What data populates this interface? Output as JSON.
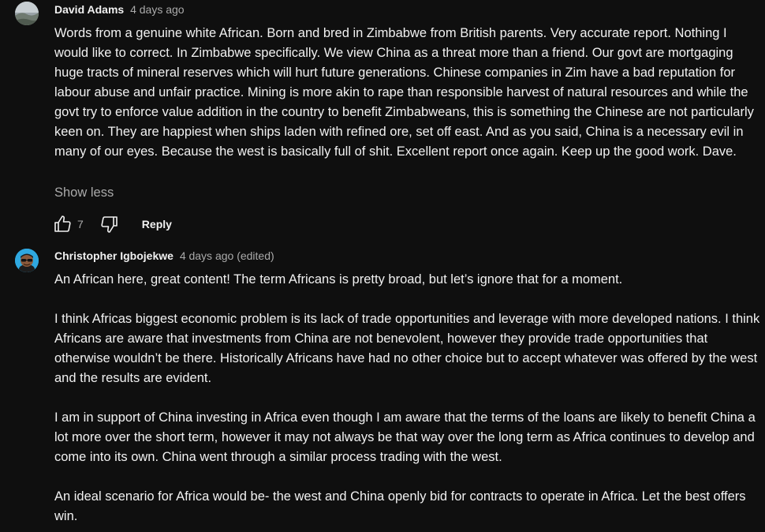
{
  "comments": [
    {
      "author": "David Adams",
      "time": "4 days ago",
      "avatar_icon": "landscape-photo-avatar",
      "paragraphs": [
        "Words from a genuine white African. Born and bred in Zimbabwe from British parents. Very accurate report. Nothing I would like to correct. In Zimbabwe specifically. We view China as a threat more than a friend. Our govt are mortgaging huge tracts of mineral reserves which will hurt future generations. Chinese companies in Zim have a bad reputation for labour abuse and unfair practice. Mining is more akin to rape than responsible harvest of natural resources and while the govt try to enforce value addition in the country to benefit Zimbabweans, this is something the Chinese are not particularly keen on. They are happiest when ships laden with refined ore, set off east. And as you said, China is a necessary evil in many of our eyes. Because the west is basically full of shit. Excellent report once again. Keep up the good work. Dave."
      ],
      "show_less": "Show less",
      "likes": "7",
      "reply": "Reply"
    },
    {
      "author": "Christopher Igbojekwe",
      "time": "4 days ago (edited)",
      "avatar_icon": "cartoon-sunglasses-avatar",
      "paragraphs": [
        "An African here, great content! The term Africans is pretty broad, but let’s ignore that for a moment.",
        "I think Africas biggest economic problem is its lack of trade opportunities and leverage with more developed nations. I think Africans are aware that investments from China are not benevolent, however they provide trade opportunities that otherwise wouldn’t be there. Historically Africans have had no other choice but to accept whatever was offered by the west and the results are evident.",
        "I am in support of China investing in Africa even though I am aware that the terms of the loans are likely to benefit China a lot more over the short term, however it may not always be that way over the long term as Africa continues to develop and come into its own. China went through a similar process trading with the west.",
        "An ideal scenario for Africa would be- the west and China openly bid for contracts to operate in Africa. Let the best offers win."
      ]
    }
  ],
  "colors": {
    "background": "#0f0f0f",
    "text_primary": "#f1f1f1",
    "text_secondary": "#aaaaaa",
    "avatar_blue": "#2fa8e0"
  }
}
